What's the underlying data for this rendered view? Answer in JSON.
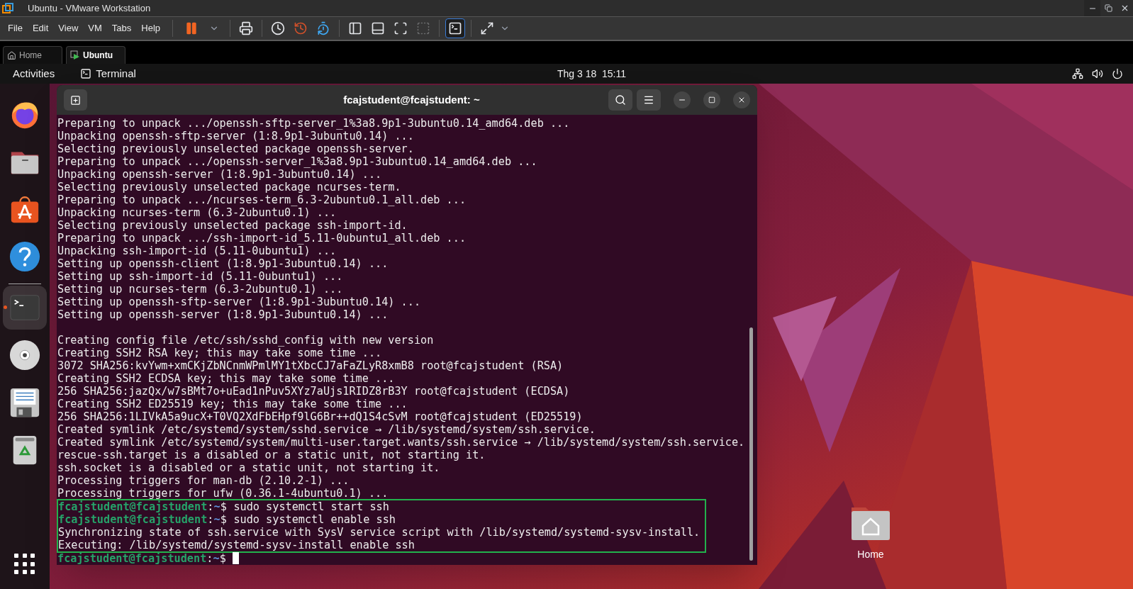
{
  "window": {
    "title": "Ubuntu - VMware Workstation"
  },
  "menu": [
    "File",
    "Edit",
    "View",
    "VM",
    "Tabs",
    "Help"
  ],
  "toolbar_buttons": [
    {
      "selected": false,
      "disabled": false
    },
    {
      "selected": false,
      "disabled": false
    },
    {
      "selected": false,
      "disabled": false
    },
    {
      "selected": false,
      "disabled": false
    },
    {
      "selected": false,
      "disabled": false
    },
    {
      "selected": false,
      "disabled": false
    },
    {
      "selected": false,
      "disabled": false
    },
    {
      "selected": false,
      "disabled": false
    },
    {
      "selected": false,
      "disabled": false
    },
    {
      "selected": false,
      "disabled": true
    },
    {
      "selected": true,
      "disabled": false
    },
    {
      "selected": false,
      "disabled": false
    }
  ],
  "tabs": [
    {
      "label": "Home",
      "selected": false
    },
    {
      "label": "Ubuntu",
      "selected": true
    }
  ],
  "top_bar": {
    "activities": "Activities",
    "app": "Terminal",
    "clock": "Thg 3 18  15:11"
  },
  "dock": [
    {
      "selected": false,
      "running": false
    },
    {
      "selected": false,
      "running": false
    },
    {
      "selected": false,
      "running": false
    },
    {
      "selected": false,
      "running": false
    },
    {
      "selected": true,
      "running": true
    },
    {
      "selected": false,
      "running": false
    },
    {
      "selected": false,
      "running": false
    },
    {
      "selected": false,
      "running": false
    }
  ],
  "terminal": {
    "title": "fcajstudent@fcajstudent: ~",
    "lines": [
      {
        "kind": "output",
        "text": "Preparing to unpack .../openssh-sftp-server_1%3a8.9p1-3ubuntu0.14_amd64.deb ..."
      },
      {
        "kind": "output",
        "text": "Unpacking openssh-sftp-server (1:8.9p1-3ubuntu0.14) ..."
      },
      {
        "kind": "output",
        "text": "Selecting previously unselected package openssh-server."
      },
      {
        "kind": "output",
        "text": "Preparing to unpack .../openssh-server_1%3a8.9p1-3ubuntu0.14_amd64.deb ..."
      },
      {
        "kind": "output",
        "text": "Unpacking openssh-server (1:8.9p1-3ubuntu0.14) ..."
      },
      {
        "kind": "output",
        "text": "Selecting previously unselected package ncurses-term."
      },
      {
        "kind": "output",
        "text": "Preparing to unpack .../ncurses-term_6.3-2ubuntu0.1_all.deb ..."
      },
      {
        "kind": "output",
        "text": "Unpacking ncurses-term (6.3-2ubuntu0.1) ..."
      },
      {
        "kind": "output",
        "text": "Selecting previously unselected package ssh-import-id."
      },
      {
        "kind": "output",
        "text": "Preparing to unpack .../ssh-import-id_5.11-0ubuntu1_all.deb ..."
      },
      {
        "kind": "output",
        "text": "Unpacking ssh-import-id (5.11-0ubuntu1) ..."
      },
      {
        "kind": "output",
        "text": "Setting up openssh-client (1:8.9p1-3ubuntu0.14) ..."
      },
      {
        "kind": "output",
        "text": "Setting up ssh-import-id (5.11-0ubuntu1) ..."
      },
      {
        "kind": "output",
        "text": "Setting up ncurses-term (6.3-2ubuntu0.1) ..."
      },
      {
        "kind": "output",
        "text": "Setting up openssh-sftp-server (1:8.9p1-3ubuntu0.14) ..."
      },
      {
        "kind": "output",
        "text": "Setting up openssh-server (1:8.9p1-3ubuntu0.14) ..."
      },
      {
        "kind": "blank"
      },
      {
        "kind": "output",
        "text": "Creating config file /etc/ssh/sshd_config with new version"
      },
      {
        "kind": "output",
        "text": "Creating SSH2 RSA key; this may take some time ..."
      },
      {
        "kind": "output",
        "text": "3072 SHA256:kvYwm+xmCKjZbNCnmWPmlMY1tXbcCJ7aFaZLyR8xmB8 root@fcajstudent (RSA)"
      },
      {
        "kind": "output",
        "text": "Creating SSH2 ECDSA key; this may take some time ..."
      },
      {
        "kind": "output",
        "text": "256 SHA256:jazQx/w7sBMt7o+uEad1nPuv5XYz7aUjs1RIDZ8rB3Y root@fcajstudent (ECDSA)"
      },
      {
        "kind": "output",
        "text": "Creating SSH2 ED25519 key; this may take some time ..."
      },
      {
        "kind": "output",
        "text": "256 SHA256:1LIVkA5a9ucX+T0VQ2XdFbEHpf9lG6Br++dQ1S4cSvM root@fcajstudent (ED25519)"
      },
      {
        "kind": "output",
        "text": "Created symlink /etc/systemd/system/sshd.service → /lib/systemd/system/ssh.service."
      },
      {
        "kind": "output",
        "text": "Created symlink /etc/systemd/system/multi-user.target.wants/ssh.service → /lib/systemd/system/ssh.service."
      },
      {
        "kind": "output",
        "text": "rescue-ssh.target is a disabled or a static unit, not starting it."
      },
      {
        "kind": "output",
        "text": "ssh.socket is a disabled or a static unit, not starting it."
      },
      {
        "kind": "output",
        "text": "Processing triggers for man-db (2.10.2-1) ..."
      },
      {
        "kind": "output",
        "text": "Processing triggers for ufw (0.36.1-4ubuntu0.1) ..."
      }
    ],
    "highlight_box": {
      "lines": [
        {
          "kind": "prompt",
          "user_host": "fcajstudent@fcajstudent",
          "separator": ":",
          "path": "~",
          "symbol": "$",
          "command": "sudo systemctl start ssh"
        },
        {
          "kind": "prompt",
          "user_host": "fcajstudent@fcajstudent",
          "separator": ":",
          "path": "~",
          "symbol": "$",
          "command": "sudo systemctl enable ssh"
        },
        {
          "kind": "output",
          "text": "Synchronizing state of ssh.service with SysV service script with /lib/systemd/systemd-sysv-install."
        },
        {
          "kind": "output",
          "text": "Executing: /lib/systemd/systemd-sysv-install enable ssh"
        }
      ]
    },
    "trailing_lines": [
      {
        "kind": "prompt",
        "user_host": "fcajstudent@fcajstudent",
        "separator": ":",
        "path": "~",
        "symbol": "$",
        "cursor": true
      }
    ]
  },
  "desktop_icons": [
    {
      "label": "Home"
    }
  ]
}
